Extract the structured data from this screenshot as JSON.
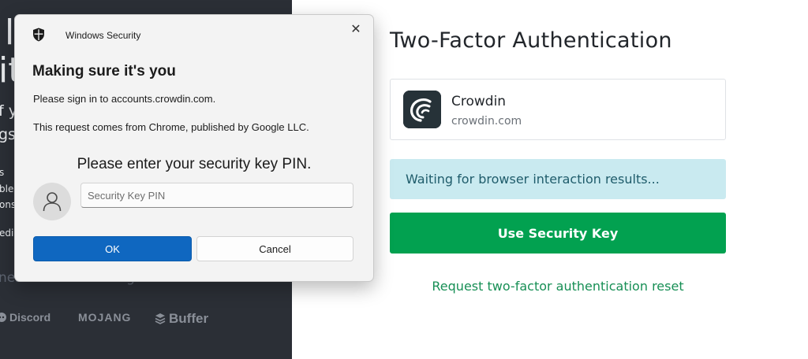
{
  "background_panel": {
    "heading_line1": "l",
    "heading_line2": "it",
    "text_line1": "f y",
    "text_line2": "gs,",
    "small1": "s",
    "small2": "ble",
    "small3": "ons",
    "small4": "edi",
    "footer_text": "nesses around the globe",
    "logos": [
      "Discord",
      "MOJANG",
      "Buffer"
    ]
  },
  "page": {
    "title": "Two-Factor Authentication",
    "app": {
      "name": "Crowdin",
      "domain": "crowdin.com"
    },
    "waiting_message": "Waiting for browser interaction results...",
    "use_key_button": "Use Security Key",
    "reset_link": "Request two-factor authentication reset"
  },
  "dialog": {
    "app_title": "Windows Security",
    "close_glyph": "✕",
    "heading": "Making sure it's you",
    "line1": "Please sign in to accounts.crowdin.com.",
    "line2": "This request comes from Chrome, published by Google LLC.",
    "prompt": "Please enter your security key PIN.",
    "pin_placeholder": "Security Key PIN",
    "pin_value": "",
    "ok_label": "OK",
    "cancel_label": "Cancel"
  },
  "colors": {
    "left_panel_bg": "#2b2f36",
    "primary_green": "#02a150",
    "link_green": "#178f55",
    "info_bg": "#c9eaf0",
    "windows_blue": "#0f67c0"
  },
  "icons": [
    "shield-icon",
    "close-icon",
    "user-icon",
    "crowdin-logo-icon",
    "discord-logo-icon",
    "mojang-logo-icon",
    "buffer-logo-icon"
  ]
}
